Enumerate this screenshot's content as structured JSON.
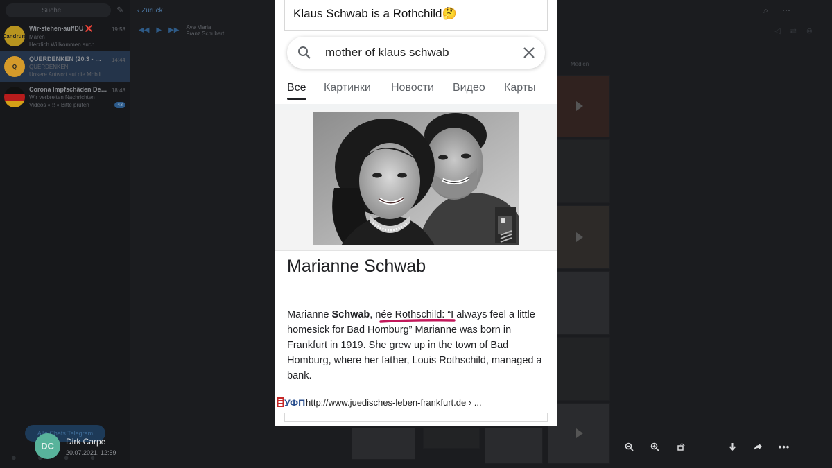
{
  "telegram": {
    "search_placeholder": "Suche",
    "back_label": "Zurück",
    "player": {
      "title": "Ave Maria",
      "artist": "Franz Schubert"
    },
    "media_tab": "Medien",
    "chats": [
      {
        "name": "Wir-stehen-auf/DU ❌",
        "message": "Maren",
        "message2": "Herzlich Willkommen auch …",
        "time": "19:58",
        "avatar_text": "Candrum",
        "avatar_color": "#b7941f"
      },
      {
        "name": "QUERDENKEN (20.3 - …",
        "message": "QUERDENKEN",
        "message2": "Unsere Antwort auf die Mobili…",
        "time": "14:44",
        "avatar_text": "Q",
        "avatar_color": "#d49a2a",
        "active": true
      },
      {
        "name": "Corona Impfschäden De…",
        "message": "Wir verbreiten Nachrichten",
        "message2": "Videos ♦ !! ♦ Bitte prüfen",
        "time": "18:48",
        "badge": "43",
        "avatar_text": "",
        "avatar_color": "#b71c1c"
      }
    ],
    "archive_button": "Alle Chats Telegram"
  },
  "viewer": {
    "author_initials": "DC",
    "author_name": "Dirk Carpe",
    "date": "20.07.2021, 12:59",
    "accent": "#58b39b"
  },
  "photo": {
    "tweet_text": "Klaus Schwab is a Rothchild🤔",
    "search_query": "mother of klaus schwab",
    "tabs": [
      "Все",
      "Картинки",
      "Новости",
      "Видео",
      "Карты"
    ],
    "active_tab": "Все",
    "person_name": "Marianne Schwab",
    "bio": {
      "before": "Marianne ",
      "bold": "Schwab",
      "after_bold": ", ",
      "underlined": "née Rothschild:",
      "rest": " “I always feel a little homesick for Bad Homburg” Marianne was born in Frankfurt in 1919. She grew up in the town of Bad Homburg, where her father, Louis Rothschild, managed a bank."
    },
    "source_logo": "УФПЛН",
    "source_url": "http://www.juedisches-leben-frankfurt.de › ..."
  }
}
